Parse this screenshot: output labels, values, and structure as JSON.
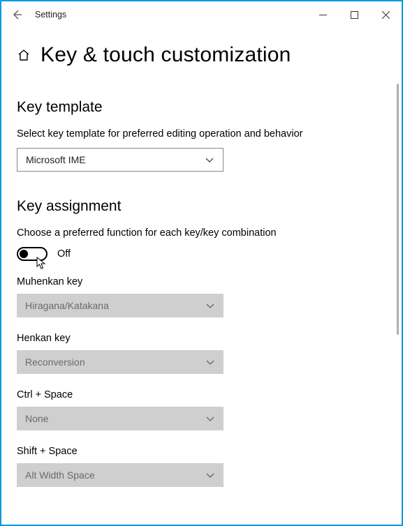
{
  "window": {
    "title": "Settings"
  },
  "page": {
    "title": "Key & touch customization"
  },
  "section1": {
    "heading": "Key template",
    "desc": "Select key template for preferred editing operation and behavior",
    "select_value": "Microsoft IME"
  },
  "section2": {
    "heading": "Key assignment",
    "desc": "Choose a preferred function for each key/key combination",
    "toggle_state_label": "Off",
    "fields": [
      {
        "label": "Muhenkan key",
        "value": "Hiragana/Katakana"
      },
      {
        "label": "Henkan key",
        "value": "Reconversion"
      },
      {
        "label": "Ctrl + Space",
        "value": "None"
      },
      {
        "label": "Shift + Space",
        "value": "Alt Width Space"
      }
    ]
  },
  "colors": {
    "accent": "#0099e5"
  }
}
